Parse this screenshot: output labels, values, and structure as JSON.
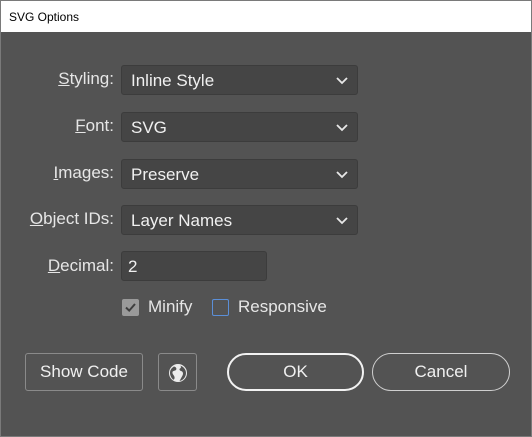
{
  "window": {
    "title": "SVG Options"
  },
  "fields": {
    "styling": {
      "label_accel": "S",
      "label_rest": "tyling:",
      "value": "Inline Style"
    },
    "font": {
      "label_accel": "F",
      "label_rest": "ont:",
      "value": "SVG"
    },
    "images": {
      "label_accel": "I",
      "label_rest": "mages:",
      "value": "Preserve"
    },
    "object_ids": {
      "label_accel": "O",
      "label_rest": "bject IDs:",
      "value": "Layer Names"
    },
    "decimal": {
      "label_accel": "D",
      "label_rest": "ecimal:",
      "value": "2"
    }
  },
  "options": {
    "minify": {
      "label": "Minify",
      "checked": true
    },
    "responsive": {
      "label": "Responsive",
      "checked": false
    }
  },
  "buttons": {
    "show_code": "Show Code",
    "ok": "OK",
    "cancel": "Cancel"
  },
  "icons": {
    "dropdown": "chevron-down-icon",
    "web": "globe-icon",
    "check": "checkmark-icon"
  },
  "colors": {
    "dialog_bg": "#535353",
    "field_bg": "#454545",
    "text": "#e6e6e6",
    "checkbox_focus": "#5b8fd8"
  }
}
